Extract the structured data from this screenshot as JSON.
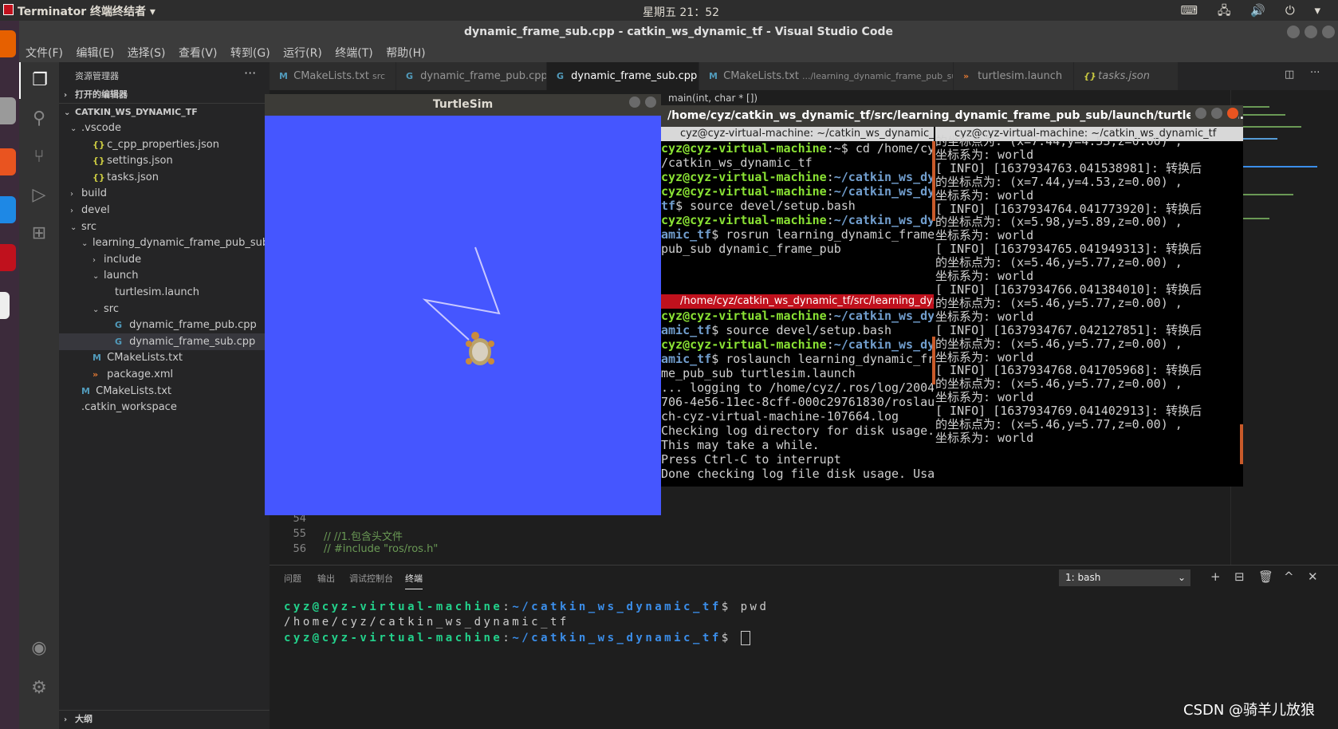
{
  "topbar": {
    "app_name": "Terminator 终端终结者 ▾",
    "clock": "星期五 21：52",
    "tray": "⌨ 🖧 🔊 ⏻ ▾"
  },
  "vscode": {
    "title": "dynamic_frame_sub.cpp - catkin_ws_dynamic_tf - Visual Studio Code",
    "menu": [
      "文件(F)",
      "编辑(E)",
      "选择(S)",
      "查看(V)",
      "转到(G)",
      "运行(R)",
      "终端(T)",
      "帮助(H)"
    ],
    "explorer": {
      "header": "资源管理器",
      "more": "···",
      "open_editors": "打开的编辑器",
      "workspace": "CATKIN_WS_DYNAMIC_TF",
      "items": [
        {
          "chev": "⌄",
          "icon": "",
          "label": ".vscode"
        },
        {
          "chev": "",
          "icon": "{}",
          "label": "c_cpp_properties.json"
        },
        {
          "chev": "",
          "icon": "{}",
          "label": "settings.json"
        },
        {
          "chev": "",
          "icon": "{}",
          "label": "tasks.json"
        },
        {
          "chev": "›",
          "icon": "",
          "label": "build"
        },
        {
          "chev": "›",
          "icon": "",
          "label": "devel"
        },
        {
          "chev": "⌄",
          "icon": "",
          "label": "src"
        },
        {
          "chev": "⌄",
          "icon": "",
          "label": "learning_dynamic_frame_pub_sub"
        },
        {
          "chev": "›",
          "icon": "",
          "label": "include"
        },
        {
          "chev": "⌄",
          "icon": "",
          "label": "launch"
        },
        {
          "chev": "",
          "icon": "",
          "label": "turtlesim.launch"
        },
        {
          "chev": "⌄",
          "icon": "",
          "label": "src"
        },
        {
          "chev": "",
          "icon": "G",
          "label": "dynamic_frame_pub.cpp"
        },
        {
          "chev": "",
          "icon": "G",
          "label": "dynamic_frame_sub.cpp"
        },
        {
          "chev": "",
          "icon": "M",
          "label": "CMakeLists.txt"
        },
        {
          "chev": "",
          "icon": "»",
          "label": "package.xml"
        },
        {
          "chev": "",
          "icon": "M",
          "label": "CMakeLists.txt"
        },
        {
          "chev": "",
          "icon": "",
          "label": ".catkin_workspace"
        }
      ],
      "outline": "大纲"
    },
    "tabs": [
      {
        "icon": "M",
        "label": "CMakeLists.txt",
        "sub": "src"
      },
      {
        "icon": "G",
        "label": "dynamic_frame_pub.cpp",
        "sub": ""
      },
      {
        "icon": "G",
        "label": "dynamic_frame_sub.cpp",
        "sub": "",
        "close": "✕"
      },
      {
        "icon": "M",
        "label": "CMakeLists.txt",
        "sub": ".../learning_dynamic_frame_pub_sub"
      },
      {
        "icon": "»",
        "label": "turtlesim.launch",
        "sub": ""
      },
      {
        "icon": "{}",
        "label": "tasks.json",
        "sub": ""
      }
    ],
    "breadcrumb": "main(int, char * [])",
    "code_lines": [
      {
        "num": "54",
        "text": ""
      },
      {
        "num": "55",
        "text": "// //1.包含头文件"
      },
      {
        "num": "56",
        "text": "// #include \"ros/ros.h\""
      }
    ],
    "panel": {
      "tabs": [
        "问题",
        "输出",
        "调试控制台",
        "终端"
      ],
      "shell": "1: bash",
      "actions": [
        "+",
        "⊟",
        "🗑",
        "^",
        "✕"
      ],
      "lines": [
        {
          "prompt": "cyz@cyz-virtual-machine",
          "path": "~/catkin_ws_dynamic_tf",
          "cmd": "$ pwd"
        },
        {
          "prompt": "",
          "path": "",
          "cmd": "/home/cyz/catkin_ws_dynamic_tf"
        },
        {
          "prompt": "cyz@cyz-virtual-machine",
          "path": "~/catkin_ws_dynamic_tf",
          "cmd": "$ "
        }
      ]
    }
  },
  "turtlesim": {
    "title": "TurtleSim"
  },
  "terminator": {
    "title": "/home/cyz/catkin_ws_dynamic_tf/src/learning_dynamic_frame_pub_sub/launch/turtlesim.la...",
    "left_top_header": "cyz@cyz-virtual-machine: ~/catkin_ws_dynamic_tf",
    "left_top_lines": [
      [
        [
          "g",
          "cyz@cyz-virtual-machine"
        ],
        [
          "w",
          ":~$ cd /home/cyz"
        ]
      ],
      [
        [
          "w",
          "/catkin_ws_dynamic_tf"
        ]
      ],
      [
        [
          "g",
          "cyz@cyz-virtual-machine"
        ],
        [
          "w",
          ":"
        ],
        [
          "b",
          "~/catkin_ws_dyn"
        ]
      ],
      [
        [
          "g",
          "cyz@cyz-virtual-machine"
        ],
        [
          "w",
          ":"
        ],
        [
          "b",
          "~/catkin_ws_dyn"
        ]
      ],
      [
        [
          "b",
          "tf"
        ],
        [
          "w",
          "$ source devel/setup.bash"
        ]
      ],
      [
        [
          "g",
          "cyz@cyz-virtual-machine"
        ],
        [
          "w",
          ":"
        ],
        [
          "b",
          "~/catkin_ws_dyn"
        ]
      ],
      [
        [
          "b",
          "amic_tf"
        ],
        [
          "w",
          "$ rosrun learning_dynamic_frame_"
        ]
      ],
      [
        [
          "w",
          "pub_sub dynamic_frame_pub"
        ]
      ]
    ],
    "left_bottom_header": "/home/cyz/catkin_ws_dynamic_tf/src/learning_dyn",
    "left_bottom_lines": [
      [
        [
          "g",
          "cyz@cyz-virtual-machine"
        ],
        [
          "w",
          ":"
        ],
        [
          "b",
          "~/catkin_ws_dyn"
        ]
      ],
      [
        [
          "b",
          "amic_tf"
        ],
        [
          "w",
          "$ source devel/setup.bash"
        ]
      ],
      [
        [
          "g",
          "cyz@cyz-virtual-machine"
        ],
        [
          "w",
          ":"
        ],
        [
          "b",
          "~/catkin_ws_dyn"
        ]
      ],
      [
        [
          "b",
          "amic_tf"
        ],
        [
          "w",
          "$ roslaunch learning_dynamic_fra"
        ]
      ],
      [
        [
          "w",
          "me_pub_sub turtlesim.launch"
        ]
      ],
      [
        [
          "w",
          "... logging to /home/cyz/.ros/log/20045"
        ]
      ],
      [
        [
          "w",
          "706-4e56-11ec-8cff-000c29761830/roslaun"
        ]
      ],
      [
        [
          "w",
          "ch-cyz-virtual-machine-107664.log"
        ]
      ],
      [
        [
          "w",
          "Checking log directory for disk usage."
        ]
      ],
      [
        [
          "w",
          "This may take a while."
        ]
      ],
      [
        [
          "w",
          "Press Ctrl-C to interrupt"
        ]
      ],
      [
        [
          "w",
          "Done checking log file disk usage. Usag"
        ]
      ]
    ],
    "right_header": "cyz@cyz-virtual-machine: ~/catkin_ws_dynamic_tf",
    "right_lines": [
      "的坐标点为: (x=7.44,y=4.53,z=0.00) ,",
      "坐标系为: world",
      "[ INFO] [1637934763.041538981]: 转换后",
      "的坐标点为: (x=7.44,y=4.53,z=0.00) ,",
      "坐标系为: world",
      "[ INFO] [1637934764.041773920]: 转换后",
      "的坐标点为: (x=5.98,y=5.89,z=0.00) ,",
      "坐标系为: world",
      "[ INFO] [1637934765.041949313]: 转换后",
      "的坐标点为: (x=5.46,y=5.77,z=0.00) ,",
      "坐标系为: world",
      "[ INFO] [1637934766.041384010]: 转换后",
      "的坐标点为: (x=5.46,y=5.77,z=0.00) ,",
      "坐标系为: world",
      "[ INFO] [1637934767.042127851]: 转换后",
      "的坐标点为: (x=5.46,y=5.77,z=0.00) ,",
      "坐标系为: world",
      "[ INFO] [1637934768.041705968]: 转换后",
      "的坐标点为: (x=5.46,y=5.77,z=0.00) ,",
      "坐标系为: world",
      "[ INFO] [1637934769.041402913]: 转换后",
      "的坐标点为: (x=5.46,y=5.77,z=0.00) ,",
      "坐标系为: world"
    ]
  },
  "watermark": "CSDN @骑羊儿放狼",
  "colors": {
    "turtlesim_bg": "#4556ff",
    "prompt_green": "#8ae234",
    "path_blue": "#729fcf",
    "header_red": "#c0111d"
  }
}
